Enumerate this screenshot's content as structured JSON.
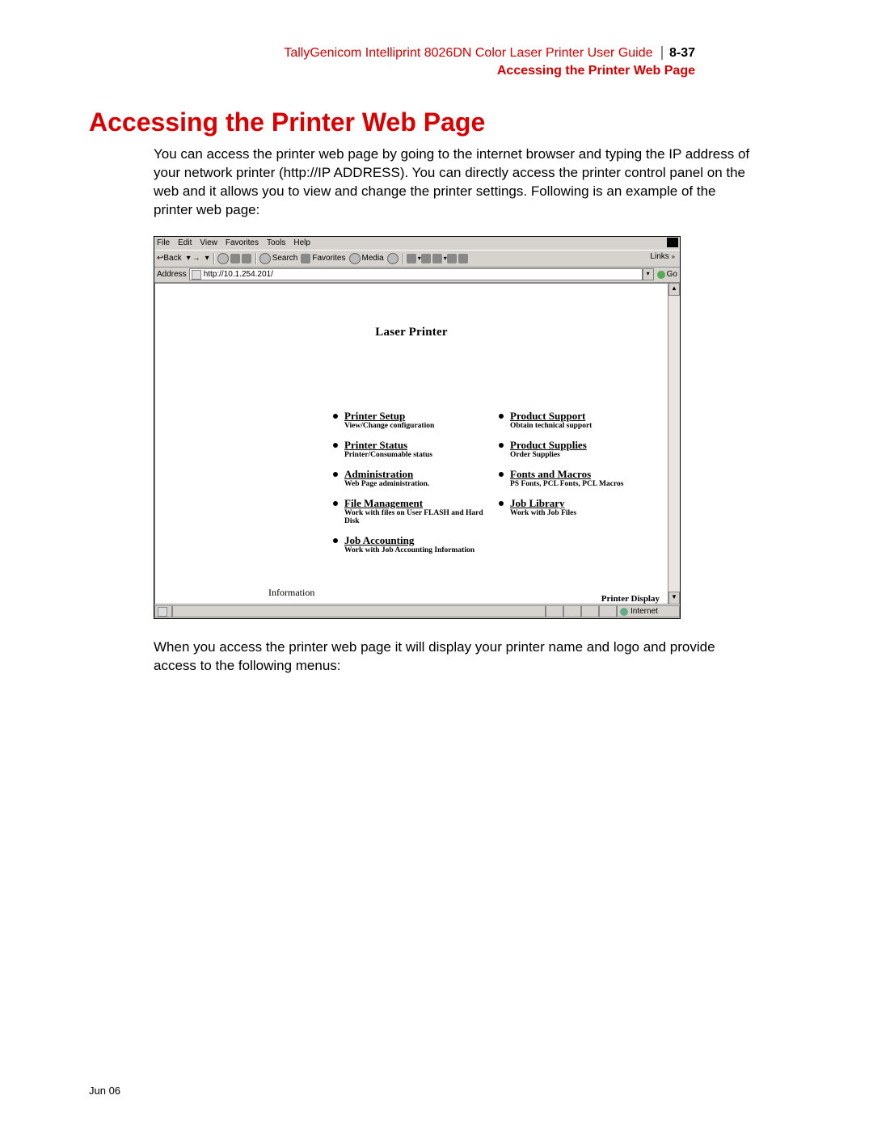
{
  "header": {
    "guide_title": "TallyGenicom Intelliprint 8026DN Color Laser Printer User Guide",
    "page_num": "8-37",
    "section_label": "Accessing the Printer Web Page"
  },
  "title": "Accessing the Printer Web Page",
  "para1": "You can access the printer web page by going to the internet browser and typing the IP address of your network printer (http://IP ADDRESS). You can directly access the printer control panel on the web and it allows you to view and change the printer settings. Following is an example of the printer web page:",
  "para2": "When you access the printer web page it will display your printer name and logo and provide access to the following menus:",
  "browser": {
    "menu": {
      "file": "File",
      "edit": "Edit",
      "view": "View",
      "fav": "Favorites",
      "tools": "Tools",
      "help": "Help"
    },
    "toolbar": {
      "back": "Back",
      "search": "Search",
      "favorites": "Favorites",
      "media": "Media"
    },
    "links_label": "Links",
    "address_label": "Address",
    "address_value": "http://10.1.254.201/",
    "go_label": "Go",
    "page_title": "Laser Printer",
    "left_links": [
      {
        "t": "Printer Setup",
        "s": "View/Change configuration"
      },
      {
        "t": "Printer Status",
        "s": "Printer/Consumable status"
      },
      {
        "t": "Administration",
        "s": "Web Page administration."
      },
      {
        "t": "File Management",
        "s": "Work with files on User FLASH and Hard Disk"
      },
      {
        "t": "Job Accounting",
        "s": "Work with Job Accounting Information"
      }
    ],
    "right_links": [
      {
        "t": "Product Support",
        "s": "Obtain technical support"
      },
      {
        "t": "Product Supplies",
        "s": "Order Supplies"
      },
      {
        "t": "Fonts and Macros",
        "s": "PS Fonts, PCL Fonts, PCL Macros"
      },
      {
        "t": "Job Library",
        "s": "Work with Job Files"
      }
    ],
    "information": "Information",
    "printer_display": "Printer Display",
    "status_internet": "Internet"
  },
  "footer_date": "Jun 06"
}
